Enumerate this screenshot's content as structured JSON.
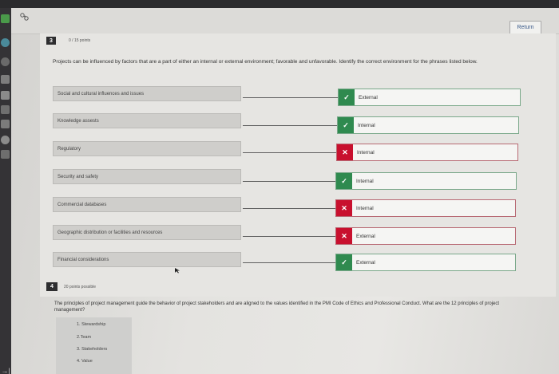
{
  "toolbar": {
    "return_label": "Return"
  },
  "question3": {
    "number": "3",
    "points": "0 / 15 points",
    "prompt": "Projects can be influenced by factors that are a part of either an internal or external environment; favorable and unfavorable. Identify the correct environment for the phrases listed below.",
    "rows": [
      {
        "phrase": "Social and cultural influences and issues",
        "answer": "External",
        "status": "correct",
        "mark": "✓"
      },
      {
        "phrase": "Knowledge assests",
        "answer": "Internal",
        "status": "correct",
        "mark": "✓"
      },
      {
        "phrase": "Regulatory",
        "answer": "Internal",
        "status": "wrong",
        "mark": "✕"
      },
      {
        "phrase": "Security and safety",
        "answer": "Internal",
        "status": "correct",
        "mark": "✓"
      },
      {
        "phrase": "Commercial databases",
        "answer": "Internal",
        "status": "wrong",
        "mark": "✕"
      },
      {
        "phrase": "Geographic distribution or facilities and resources",
        "answer": "External",
        "status": "wrong",
        "mark": "✕"
      },
      {
        "phrase": "Financial considerations",
        "answer": "External",
        "status": "correct",
        "mark": "✓"
      }
    ]
  },
  "question4": {
    "number": "4",
    "points": "20 points possible",
    "prompt": "The principles of project management guide the behavior of project stakeholders and are aligned to the values identified in the PMI Code of Ethics and Professional Conduct. What are the 12 principles of project management?",
    "items": [
      "1. Stewardship",
      "2.Team",
      "3. Stakeholders",
      "4. Value"
    ]
  },
  "colors": {
    "correct": "#2f8a4f",
    "wrong": "#c8102e"
  }
}
